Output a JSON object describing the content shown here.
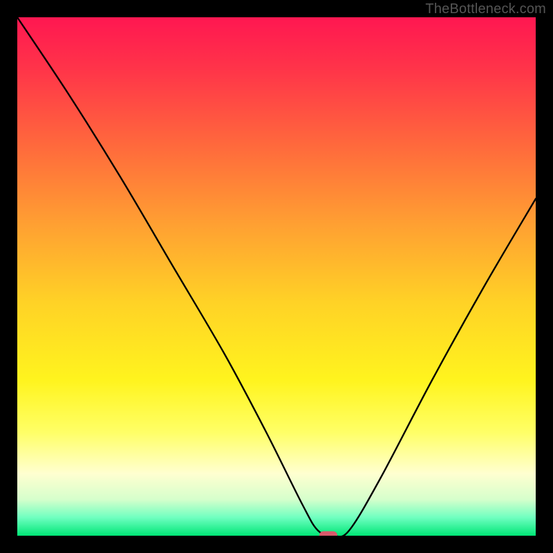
{
  "watermark": "TheBottleneck.com",
  "chart_data": {
    "type": "line",
    "title": "",
    "xlabel": "",
    "ylabel": "",
    "xlim": [
      0,
      100
    ],
    "ylim": [
      0,
      100
    ],
    "series": [
      {
        "name": "bottleneck-curve",
        "x": [
          0,
          10,
          20,
          30,
          40,
          48,
          55,
          58,
          61,
          64,
          70,
          80,
          90,
          100
        ],
        "values": [
          100,
          85,
          69,
          52,
          35,
          20,
          6,
          1,
          0,
          1,
          11,
          30,
          48,
          65
        ]
      }
    ],
    "marker": {
      "name": "optimum-marker",
      "x": 60,
      "y": 0,
      "color": "#d9596b"
    },
    "gradient_stops": [
      {
        "offset": 0.0,
        "color": "#ff1751"
      },
      {
        "offset": 0.1,
        "color": "#ff3449"
      },
      {
        "offset": 0.25,
        "color": "#ff6a3c"
      },
      {
        "offset": 0.4,
        "color": "#ffa032"
      },
      {
        "offset": 0.55,
        "color": "#ffd226"
      },
      {
        "offset": 0.7,
        "color": "#fff41e"
      },
      {
        "offset": 0.8,
        "color": "#ffff66"
      },
      {
        "offset": 0.88,
        "color": "#ffffd0"
      },
      {
        "offset": 0.93,
        "color": "#d6ffcc"
      },
      {
        "offset": 0.965,
        "color": "#6fffc0"
      },
      {
        "offset": 1.0,
        "color": "#00e676"
      }
    ]
  }
}
